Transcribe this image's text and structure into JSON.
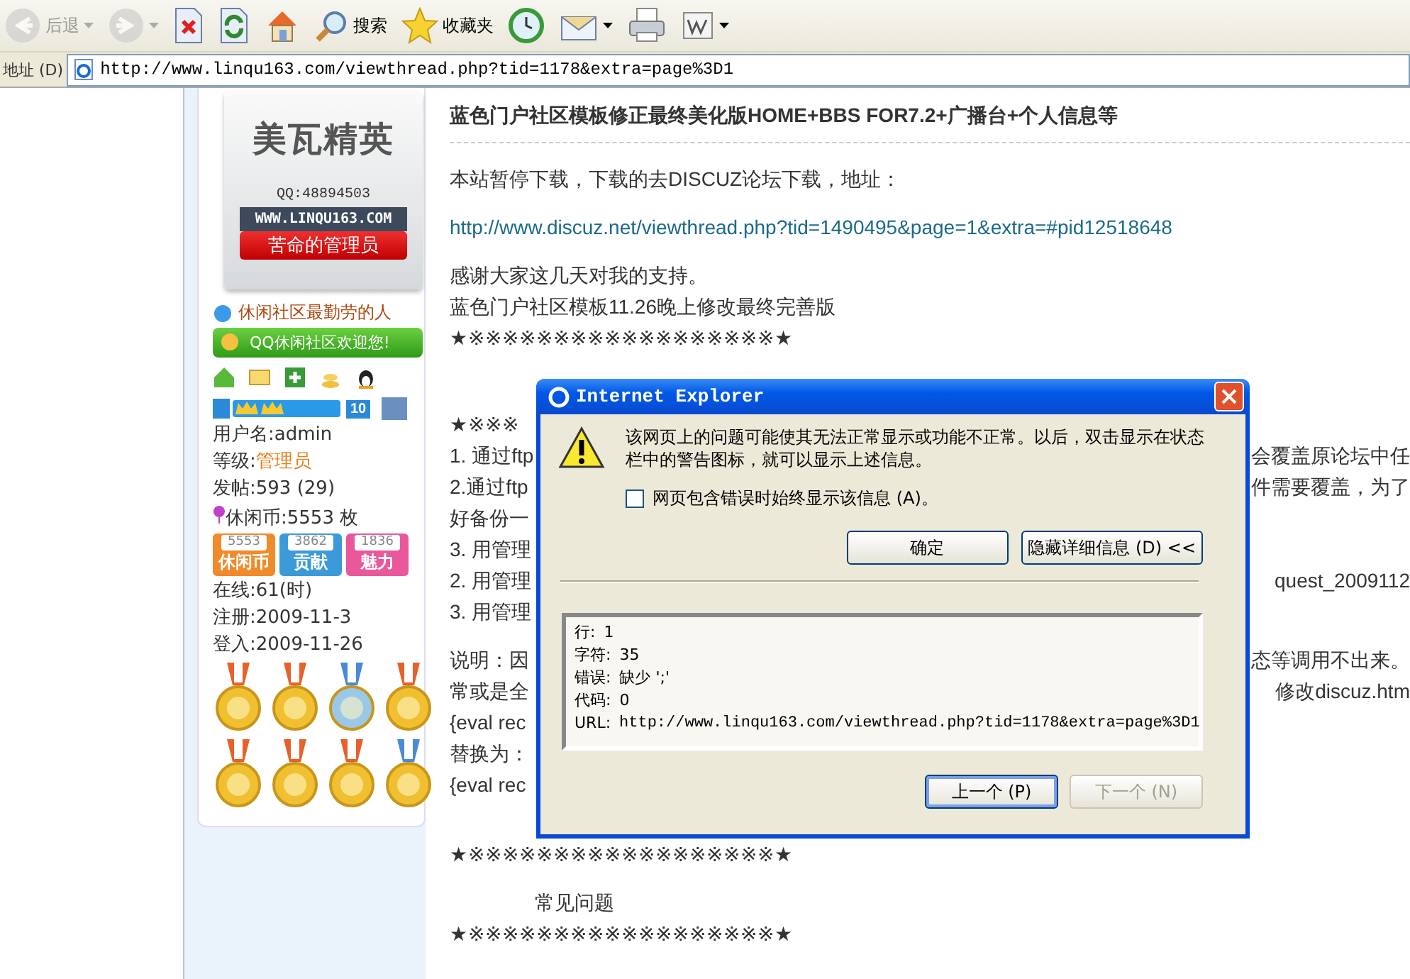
{
  "toolbar": {
    "buttons": [
      {
        "kind": "back",
        "label": "后退",
        "disabled": true,
        "menu": true
      },
      {
        "kind": "forward",
        "disabled": true,
        "menu": true
      },
      {
        "kind": "stop",
        "disabled": false,
        "menu": false
      },
      {
        "kind": "refresh",
        "disabled": false,
        "menu": false
      },
      {
        "kind": "home",
        "disabled": false,
        "menu": false
      },
      {
        "kind": "search",
        "label": "搜索",
        "disabled": false,
        "menu": false
      },
      {
        "kind": "favorites",
        "label": "收藏夹",
        "disabled": false,
        "menu": false
      },
      {
        "kind": "history",
        "disabled": false,
        "menu": false
      },
      {
        "kind": "mail",
        "disabled": false,
        "menu": true
      },
      {
        "kind": "print",
        "disabled": false,
        "menu": false
      },
      {
        "kind": "edit",
        "disabled": false,
        "menu": true
      }
    ]
  },
  "address_bar": {
    "label": "地址 (D)",
    "url": "http://www.linqu163.com/viewthread.php?tid=1178&extra=page%3D1"
  },
  "profile": {
    "avatar": {
      "logo": "美瓦精英",
      "qq": "QQ:48894503",
      "site": "WWW.LINQU163.COM",
      "title": "苦命的管理员"
    },
    "motto": "休闲社区最勤劳的人",
    "banner": "QQ休闲社区欢迎您!",
    "rank_badge": "10",
    "fields": [
      {
        "kind": "plain",
        "label": "用户名:",
        "value": "admin"
      },
      {
        "kind": "rank",
        "label": "等级:",
        "value": "管理员"
      },
      {
        "kind": "plain",
        "label": "发帖:",
        "value": "593 (29)"
      },
      {
        "kind": "pin",
        "label": "休闲币:",
        "value": "5553 枚"
      }
    ],
    "stats": [
      {
        "count": "5553",
        "label": "休闲币",
        "color": "#f08a2a"
      },
      {
        "count": "3862",
        "label": "贡献",
        "color": "#3d9ad8"
      },
      {
        "count": "1836",
        "label": "魅力",
        "color": "#e8589a"
      }
    ],
    "times": [
      {
        "label": "在线:",
        "value": "61(时)"
      },
      {
        "label": "注册:",
        "value": "2009-11-3"
      },
      {
        "label": "登入:",
        "value": "2009-11-26"
      }
    ]
  },
  "post": {
    "title": "蓝色门户社区模板修正最终美化版HOME+BBS FOR7.2+广播台+个人信息等",
    "lines": [
      {
        "kind": "paragraph",
        "left": "本站暂停下载，下载的去DISCUZ论坛下载，地址："
      },
      {
        "kind": "link",
        "left": "http://www.discuz.net/viewthread.php?tid=1490495&page=1&extra=#pid12518648"
      },
      {
        "kind": "paragraph",
        "left": "感谢大家这几天对我的支持。"
      },
      {
        "kind": "line",
        "left": "蓝色门户社区模板11.26晚上修改最终完善版"
      },
      {
        "kind": "line",
        "left": "★※※※※※※※※※※※※※※※※※※★"
      },
      {
        "kind": "section",
        "left": "★※※※"
      },
      {
        "kind": "line",
        "left": "1. 通过ftp",
        "right": "会覆盖原论坛中任"
      },
      {
        "kind": "line",
        "left": "2.通过ftp",
        "right": "件需要覆盖，为了"
      },
      {
        "kind": "line",
        "left": "好备份一"
      },
      {
        "kind": "line",
        "left": "3. 用管理"
      },
      {
        "kind": "line",
        "left": "2. 用管理",
        "right": "quest_2009112"
      },
      {
        "kind": "line",
        "left": "3. 用管理"
      },
      {
        "kind": "paragraph",
        "left": "说明：因",
        "right": "态等调用不出来。"
      },
      {
        "kind": "line",
        "left": "常或是全",
        "right": "修改discuz.htm"
      },
      {
        "kind": "line",
        "left": "{eval rec"
      },
      {
        "kind": "line",
        "left": "替换为："
      },
      {
        "kind": "line",
        "left": "{eval rec"
      },
      {
        "kind": "gap",
        "left": "★※※※※※※※※※※※※※※※※※※★"
      },
      {
        "kind": "heading",
        "left": "常见问题"
      },
      {
        "kind": "line",
        "left": "★※※※※※※※※※※※※※※※※※※★"
      }
    ]
  },
  "dialog": {
    "title": "Internet Explorer",
    "message": "该网页上的问题可能使其无法正常显示或功能不正常。以后，双击显示在状态栏中的警告图标，就可以显示上述信息。",
    "checkbox": {
      "label": "网页包含错误时始终显示该信息 (A)。",
      "checked": false
    },
    "buttons": [
      {
        "label": "确定"
      },
      {
        "label": "隐藏详细信息 (D) <<"
      }
    ],
    "details": [
      {
        "label": "行:",
        "value": "1"
      },
      {
        "label": "字符:",
        "value": "35"
      },
      {
        "label": "错误:",
        "value": "缺少 ';'"
      },
      {
        "label": "代码:",
        "value": "0"
      },
      {
        "label": "URL:",
        "value": "http://www.linqu163.com/viewthread.php?tid=1178&extra=page%3D1"
      }
    ],
    "nav_buttons": [
      {
        "label": "上一个 (P)",
        "selected": true,
        "disabled": false
      },
      {
        "label": "下一个 (N)",
        "selected": false,
        "disabled": true
      }
    ]
  }
}
